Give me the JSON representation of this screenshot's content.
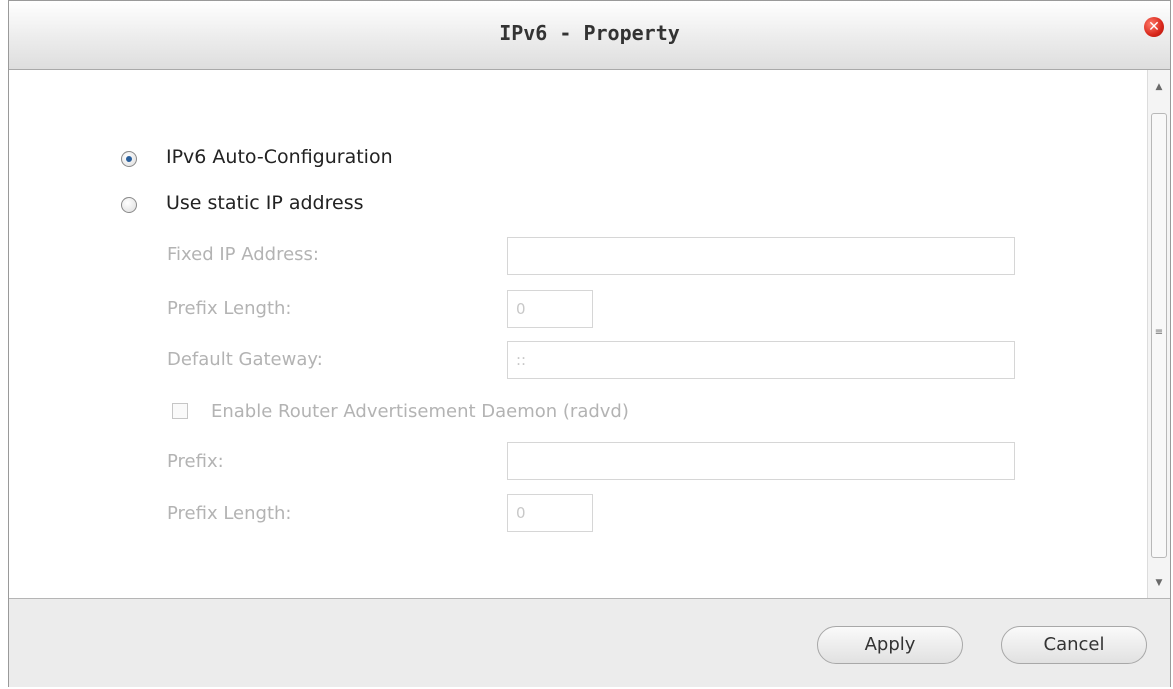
{
  "dialog": {
    "title": "IPv6 - Property",
    "close_icon": "close-icon"
  },
  "options": {
    "auto_config_label": "IPv6 Auto-Configuration",
    "auto_config_selected": true,
    "static_ip_label": "Use static IP address",
    "static_ip_selected": false
  },
  "static_fields": {
    "fixed_ip_label": "Fixed IP Address:",
    "fixed_ip_value": "",
    "prefix_length_label": "Prefix Length:",
    "prefix_length_value": "0",
    "default_gateway_label": "Default Gateway:",
    "default_gateway_value": "::"
  },
  "radvd": {
    "enable_label": "Enable Router Advertisement Daemon (radvd)",
    "enabled": false,
    "prefix_label": "Prefix:",
    "prefix_value": "",
    "prefix_length_label": "Prefix Length:",
    "prefix_length_value": "0"
  },
  "scrollbar": {
    "up_icon": "scroll-up-icon",
    "down_icon": "scroll-down-icon",
    "grip_glyph": "≡"
  },
  "footer": {
    "apply_label": "Apply",
    "cancel_label": "Cancel"
  }
}
